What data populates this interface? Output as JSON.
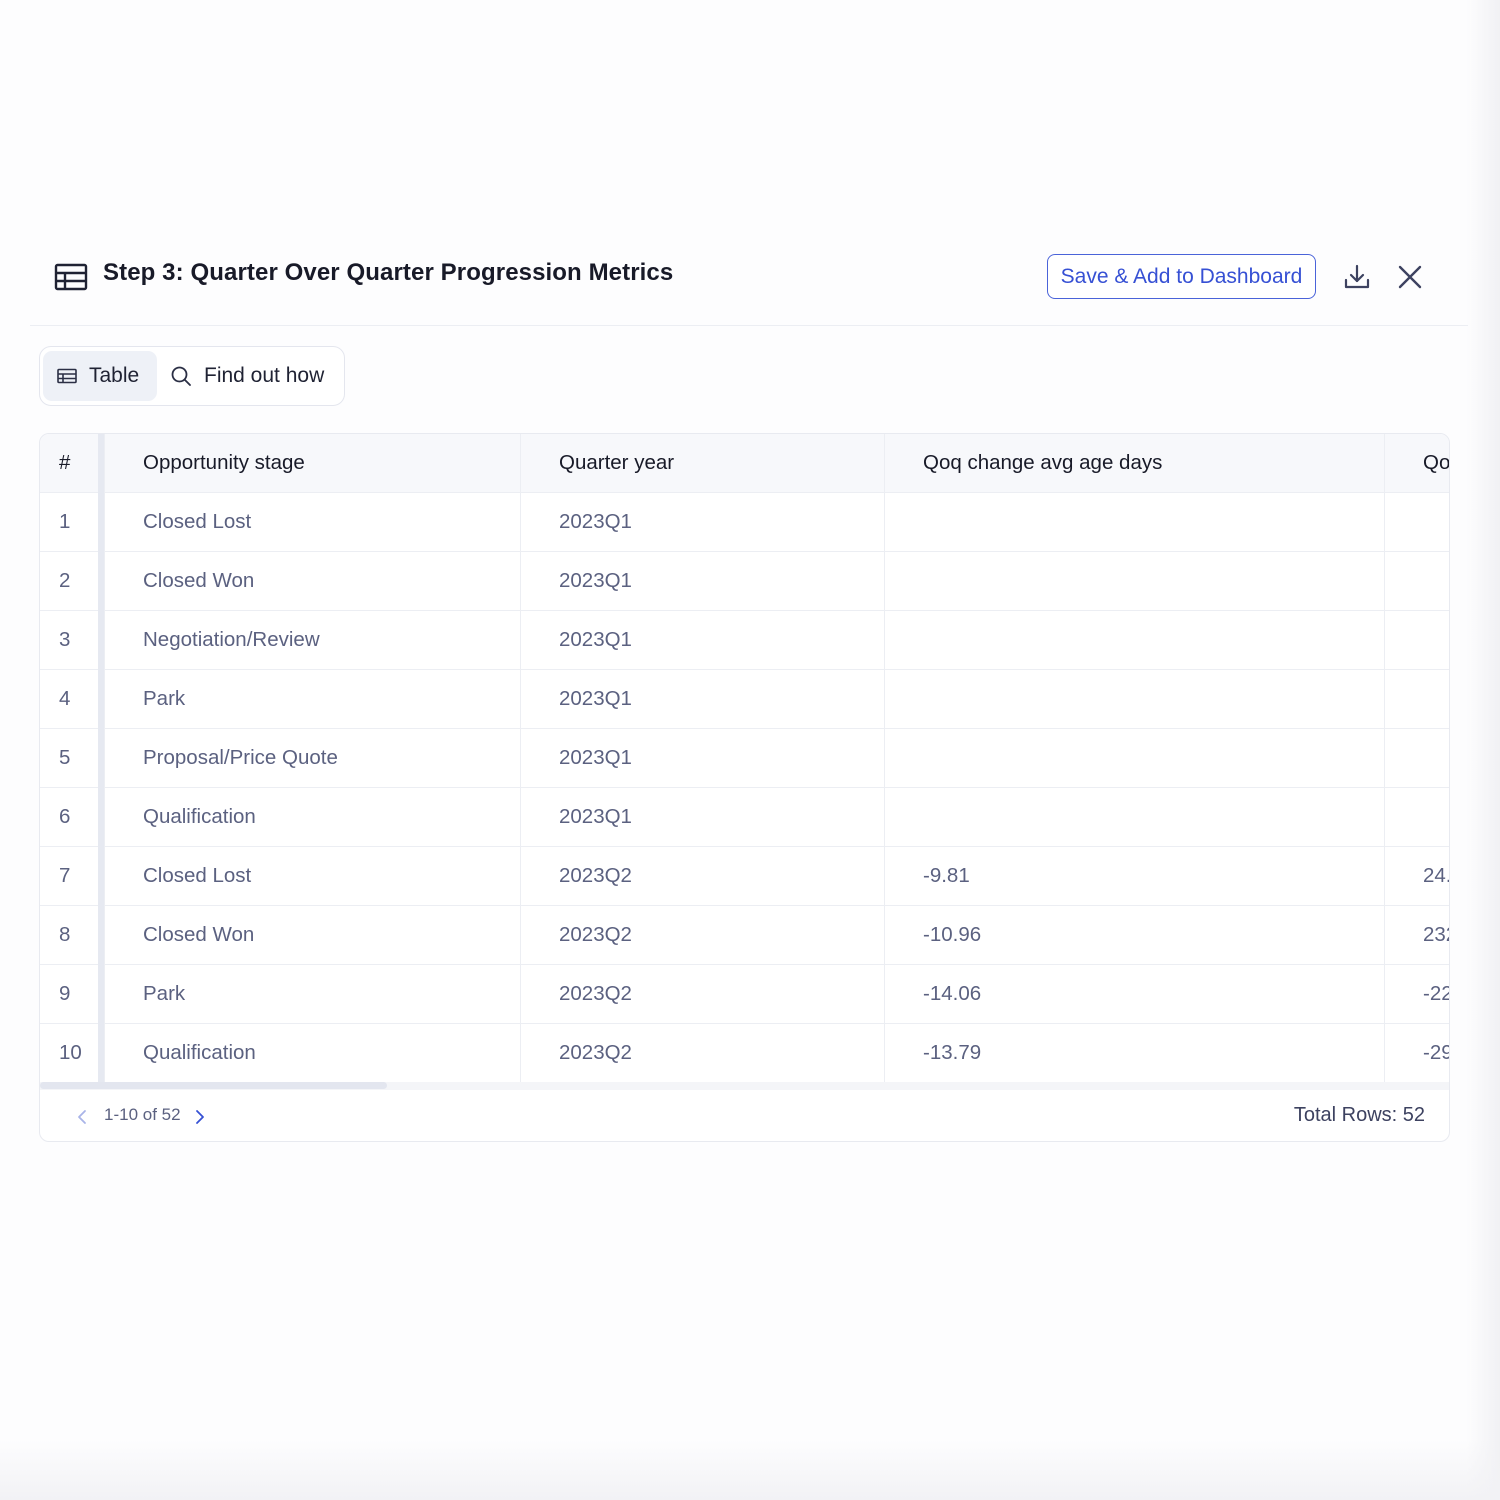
{
  "header": {
    "title": "Step 3: Quarter Over Quarter Progression Metrics",
    "save_label": "Save & Add to Dashboard",
    "icons": [
      "table-icon",
      "download-icon",
      "close-icon"
    ]
  },
  "toggle": {
    "table_label": "Table",
    "find_label": "Find out how"
  },
  "table": {
    "columns": [
      "#",
      "Opportunity stage",
      "Quarter year",
      "Qoq change avg age days",
      "Qo"
    ],
    "rows": [
      [
        "1",
        "Closed Lost",
        "2023Q1",
        "",
        ""
      ],
      [
        "2",
        "Closed Won",
        "2023Q1",
        "",
        ""
      ],
      [
        "3",
        "Negotiation/Review",
        "2023Q1",
        "",
        ""
      ],
      [
        "4",
        "Park",
        "2023Q1",
        "",
        ""
      ],
      [
        "5",
        "Proposal/Price Quote",
        "2023Q1",
        "",
        ""
      ],
      [
        "6",
        "Qualification",
        "2023Q1",
        "",
        ""
      ],
      [
        "7",
        "Closed Lost",
        "2023Q2",
        "-9.81",
        "24."
      ],
      [
        "8",
        "Closed Won",
        "2023Q2",
        "-10.96",
        "232"
      ],
      [
        "9",
        "Park",
        "2023Q2",
        "-14.06",
        "-22"
      ],
      [
        "10",
        "Qualification",
        "2023Q2",
        "-13.79",
        "-29"
      ]
    ]
  },
  "pagination": {
    "range": "1-10 of 52",
    "total": "Total Rows: 52"
  },
  "colors": {
    "accent": "#3650d4",
    "muted_text": "#5b6180",
    "header_bg": "#f7f8fb",
    "border": "#eceef3"
  }
}
